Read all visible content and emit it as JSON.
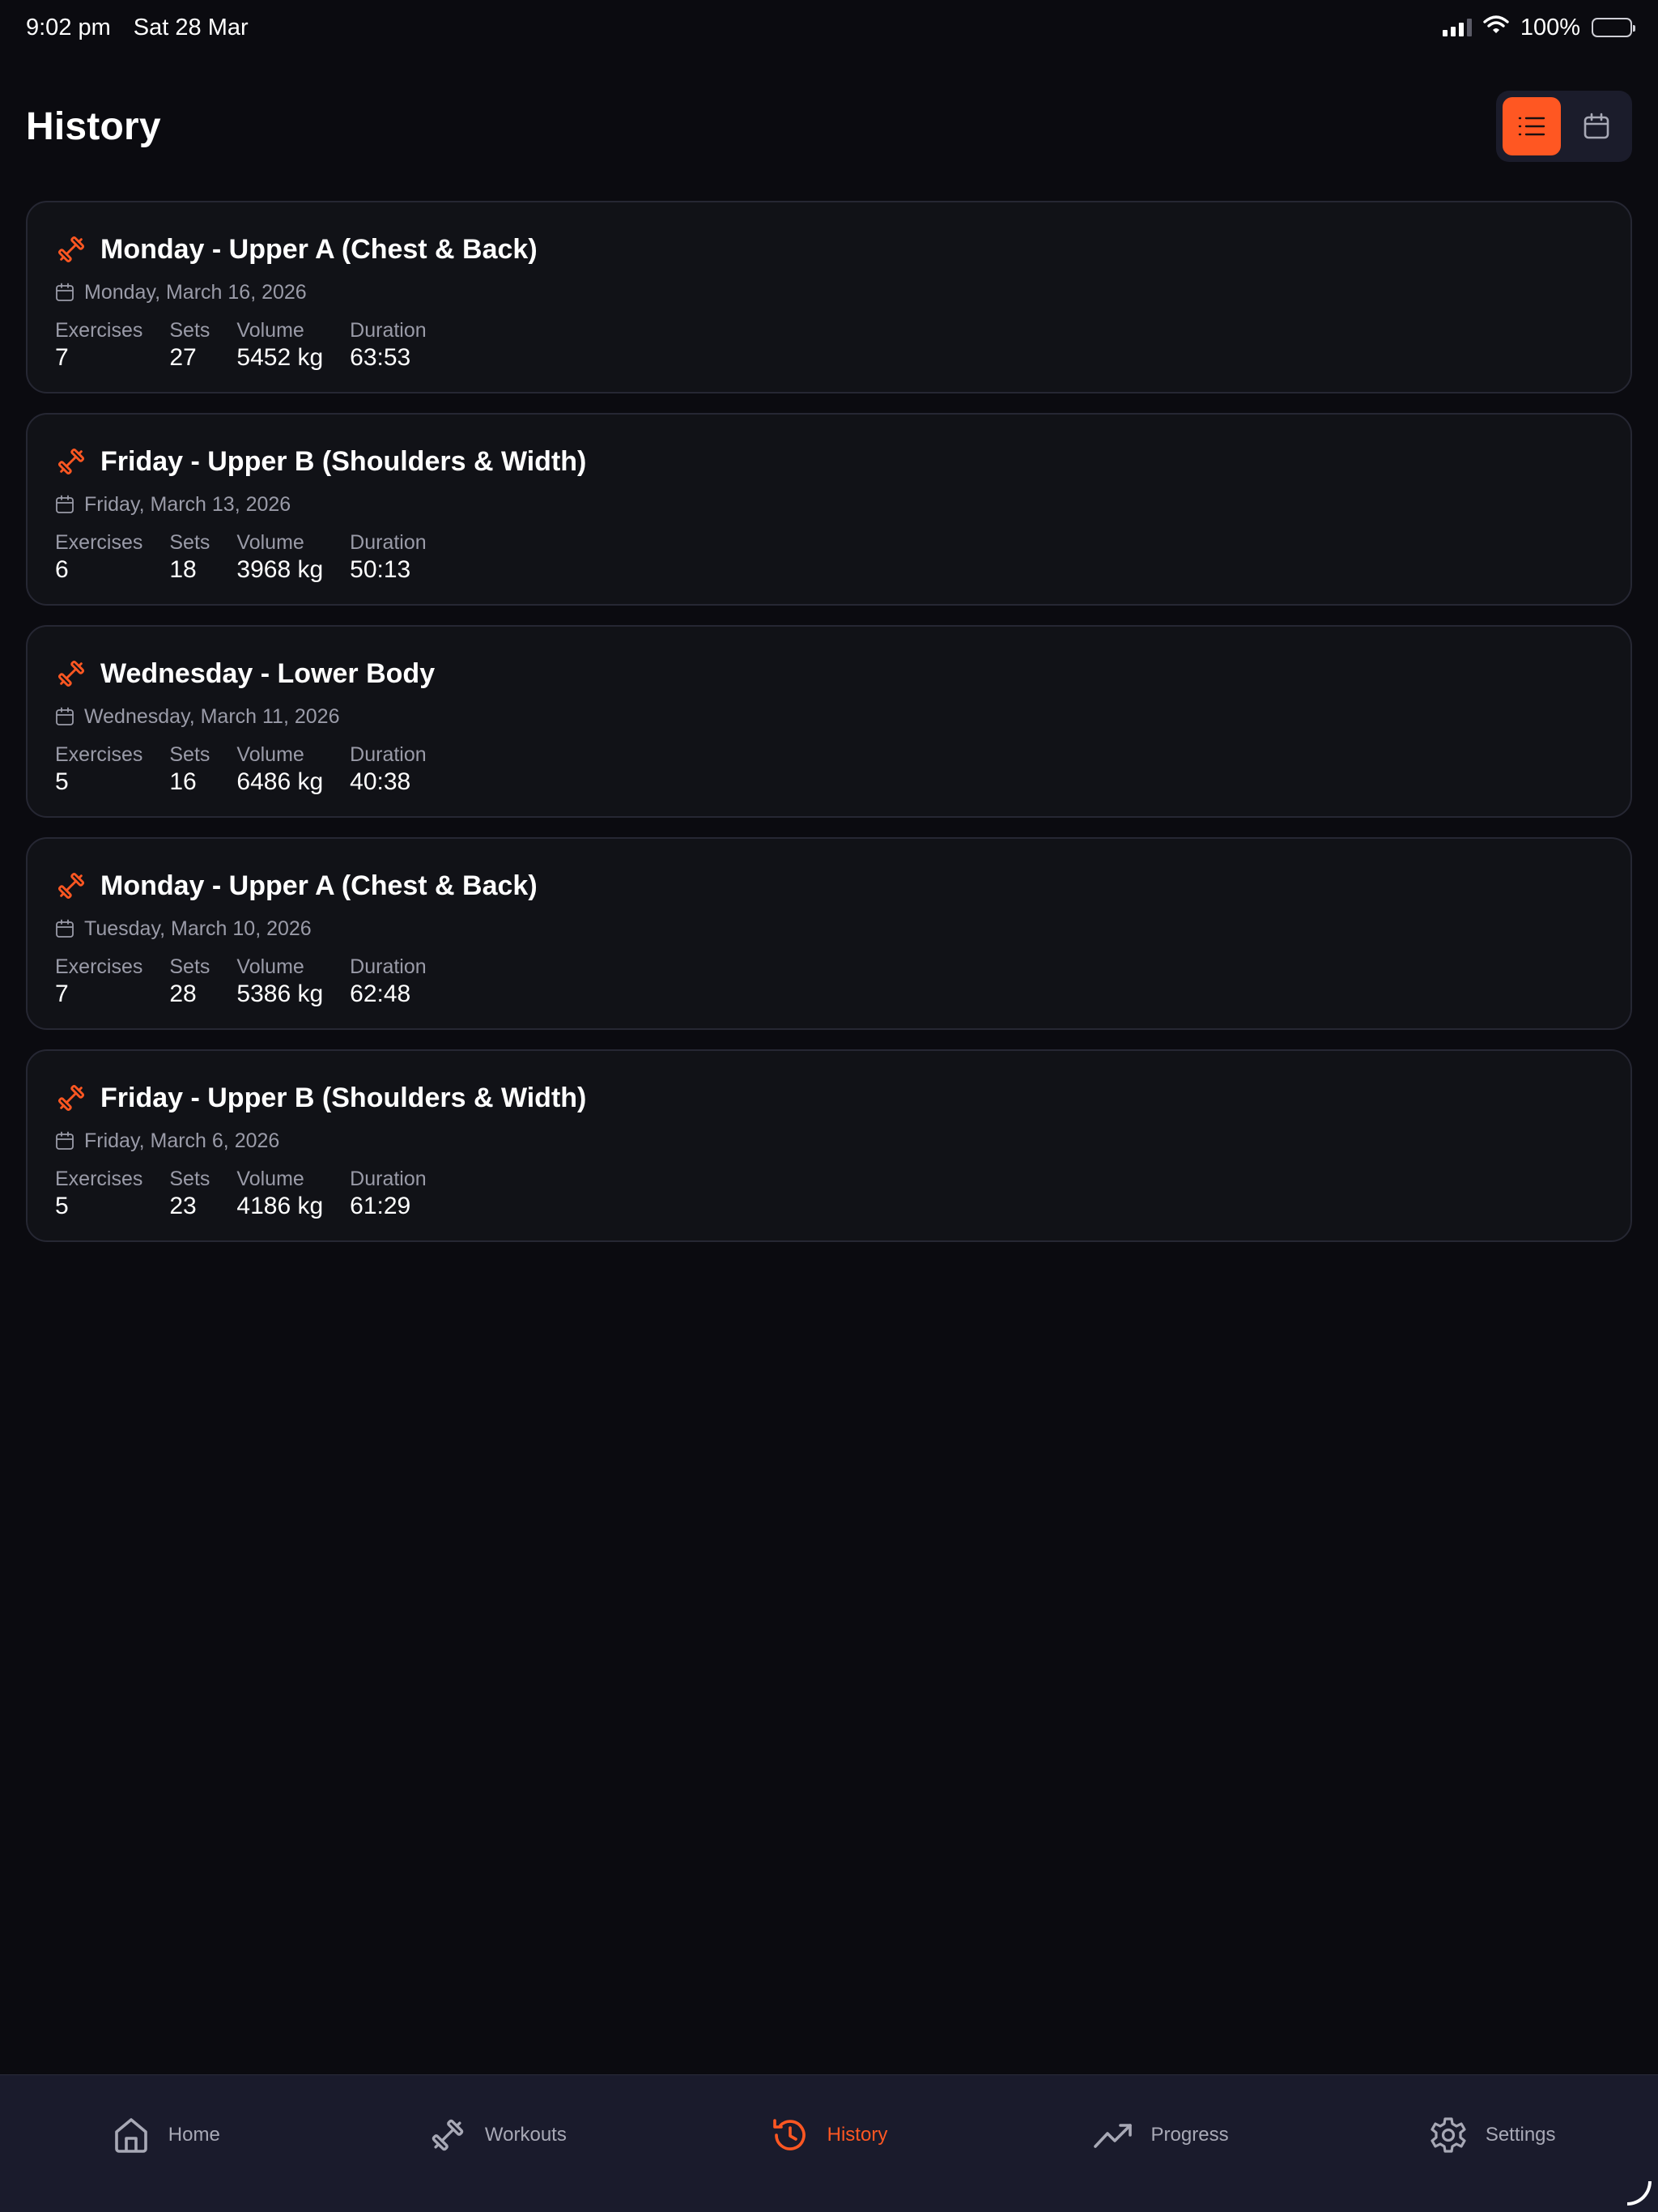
{
  "status_bar": {
    "time": "9:02 pm",
    "date": "Sat 28 Mar",
    "battery": "100%"
  },
  "header": {
    "title": "History",
    "view_modes": [
      "list",
      "calendar"
    ],
    "active_view": "list"
  },
  "colors": {
    "accent": "#ff5722",
    "background": "#0b0b10",
    "card": "#111217",
    "tab_bar": "#1a1b2c"
  },
  "stat_labels": {
    "exercises": "Exercises",
    "sets": "Sets",
    "volume": "Volume",
    "duration": "Duration"
  },
  "workouts": [
    {
      "title": "Monday - Upper A (Chest & Back)",
      "date": "Monday, March 16, 2026",
      "exercises": "7",
      "sets": "27",
      "volume": "5452 kg",
      "duration": "63:53"
    },
    {
      "title": "Friday - Upper B (Shoulders & Width)",
      "date": "Friday, March 13, 2026",
      "exercises": "6",
      "sets": "18",
      "volume": "3968 kg",
      "duration": "50:13"
    },
    {
      "title": "Wednesday - Lower Body",
      "date": "Wednesday, March 11, 2026",
      "exercises": "5",
      "sets": "16",
      "volume": "6486 kg",
      "duration": "40:38"
    },
    {
      "title": "Monday - Upper A (Chest & Back)",
      "date": "Tuesday, March 10, 2026",
      "exercises": "7",
      "sets": "28",
      "volume": "5386 kg",
      "duration": "62:48"
    },
    {
      "title": "Friday - Upper B (Shoulders & Width)",
      "date": "Friday, March 6, 2026",
      "exercises": "5",
      "sets": "23",
      "volume": "4186 kg",
      "duration": "61:29"
    }
  ],
  "tabs": [
    {
      "label": "Home",
      "icon": "home-icon"
    },
    {
      "label": "Workouts",
      "icon": "dumbbell-icon"
    },
    {
      "label": "History",
      "icon": "history-icon",
      "active": true
    },
    {
      "label": "Progress",
      "icon": "trending-up-icon"
    },
    {
      "label": "Settings",
      "icon": "gear-icon"
    }
  ]
}
